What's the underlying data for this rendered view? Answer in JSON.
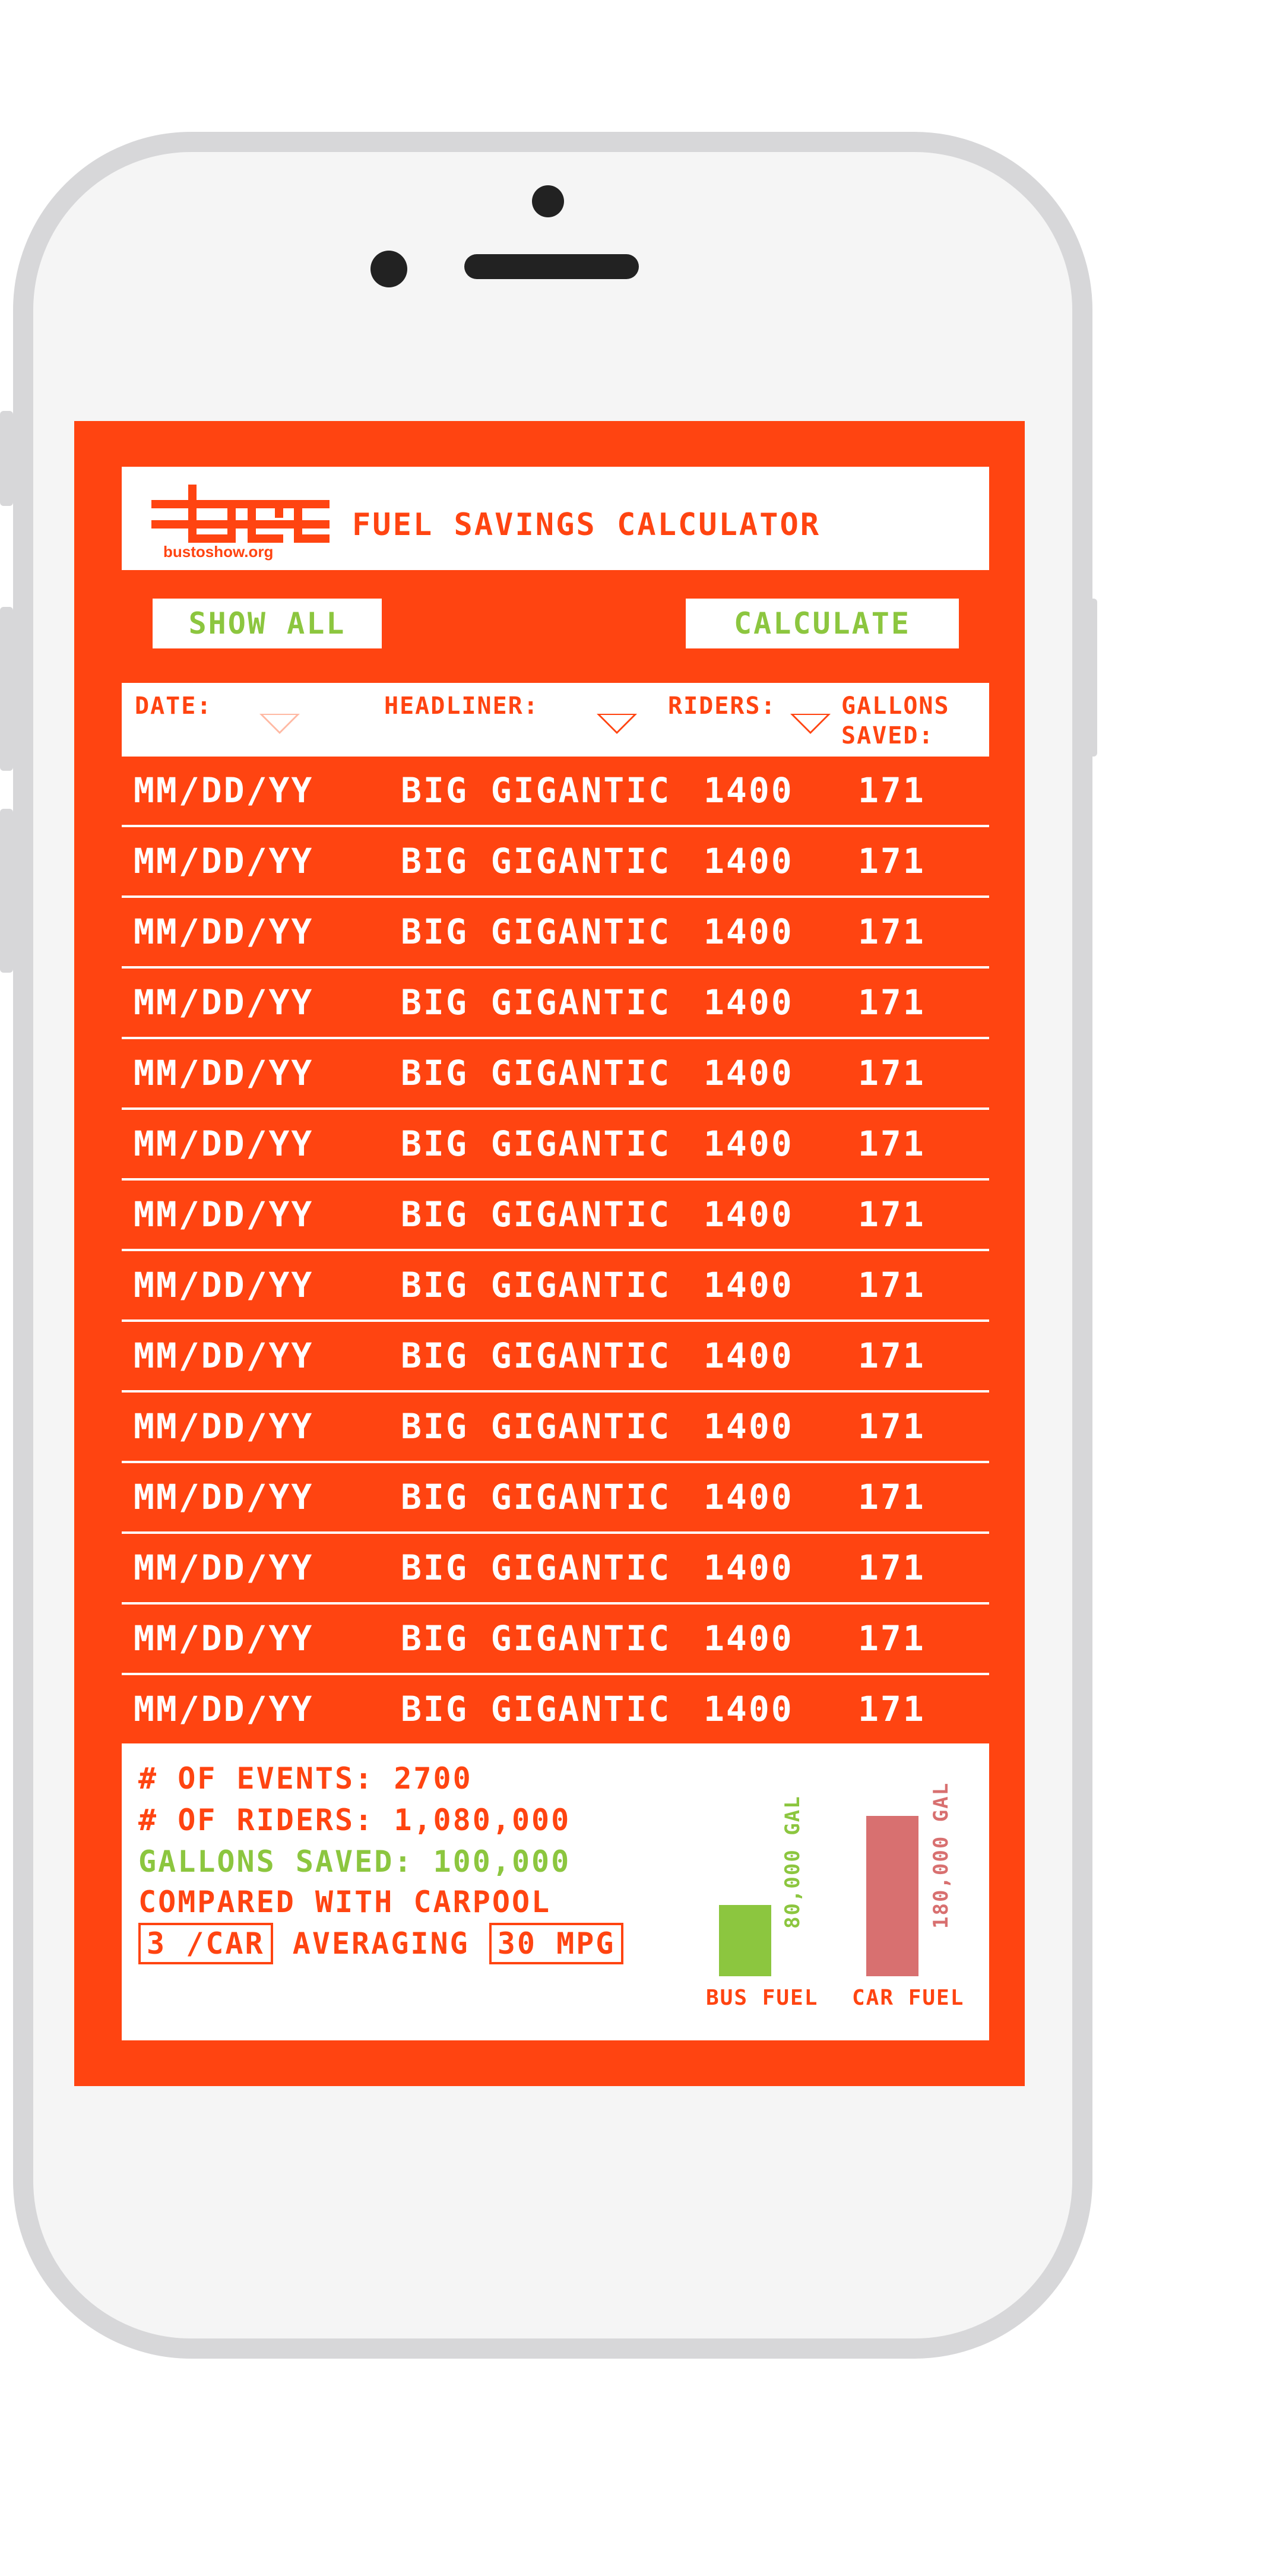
{
  "app": {
    "title": "FUEL SAVINGS CALCULATOR",
    "logo_url": "bustoshow.org"
  },
  "toolbar": {
    "show_all_label": "SHOW ALL",
    "calculate_label": "CALCULATE"
  },
  "columns": {
    "date": "DATE:",
    "headliner": "HEADLINER:",
    "riders": "RIDERS:",
    "gallons": "GALLONS SAVED:"
  },
  "rows": [
    {
      "date": "MM/DD/YY",
      "headliner": "BIG GIGANTIC",
      "riders": "1400",
      "gallons": "171"
    },
    {
      "date": "MM/DD/YY",
      "headliner": "BIG GIGANTIC",
      "riders": "1400",
      "gallons": "171"
    },
    {
      "date": "MM/DD/YY",
      "headliner": "BIG GIGANTIC",
      "riders": "1400",
      "gallons": "171"
    },
    {
      "date": "MM/DD/YY",
      "headliner": "BIG GIGANTIC",
      "riders": "1400",
      "gallons": "171"
    },
    {
      "date": "MM/DD/YY",
      "headliner": "BIG GIGANTIC",
      "riders": "1400",
      "gallons": "171"
    },
    {
      "date": "MM/DD/YY",
      "headliner": "BIG GIGANTIC",
      "riders": "1400",
      "gallons": "171"
    },
    {
      "date": "MM/DD/YY",
      "headliner": "BIG GIGANTIC",
      "riders": "1400",
      "gallons": "171"
    },
    {
      "date": "MM/DD/YY",
      "headliner": "BIG GIGANTIC",
      "riders": "1400",
      "gallons": "171"
    },
    {
      "date": "MM/DD/YY",
      "headliner": "BIG GIGANTIC",
      "riders": "1400",
      "gallons": "171"
    },
    {
      "date": "MM/DD/YY",
      "headliner": "BIG GIGANTIC",
      "riders": "1400",
      "gallons": "171"
    },
    {
      "date": "MM/DD/YY",
      "headliner": "BIG GIGANTIC",
      "riders": "1400",
      "gallons": "171"
    },
    {
      "date": "MM/DD/YY",
      "headliner": "BIG GIGANTIC",
      "riders": "1400",
      "gallons": "171"
    },
    {
      "date": "MM/DD/YY",
      "headliner": "BIG GIGANTIC",
      "riders": "1400",
      "gallons": "171"
    },
    {
      "date": "MM/DD/YY",
      "headliner": "BIG GIGANTIC",
      "riders": "1400",
      "gallons": "171"
    }
  ],
  "summary": {
    "events": "# OF EVENTS: 2700",
    "riders": "# OF RIDERS: 1,080,000",
    "gallons_saved": "GALLONS SAVED: 100,000",
    "compared": "COMPARED WITH CARPOOL",
    "per_car": "3 /CAR",
    "averaging": "AVERAGING",
    "mpg": "30 MPG"
  },
  "chart_data": {
    "type": "bar",
    "categories": [
      "BUS FUEL",
      "CAR FUEL"
    ],
    "values": [
      80000,
      180000
    ],
    "data_labels": [
      "80,000 GAL",
      "180,000 GAL"
    ],
    "colors": [
      "#8cc63f",
      "#d87070"
    ],
    "ylim": [
      0,
      180000
    ]
  },
  "theme": {
    "accent": "#ff4411",
    "green": "#8cc63f",
    "car_bar": "#d87070"
  }
}
